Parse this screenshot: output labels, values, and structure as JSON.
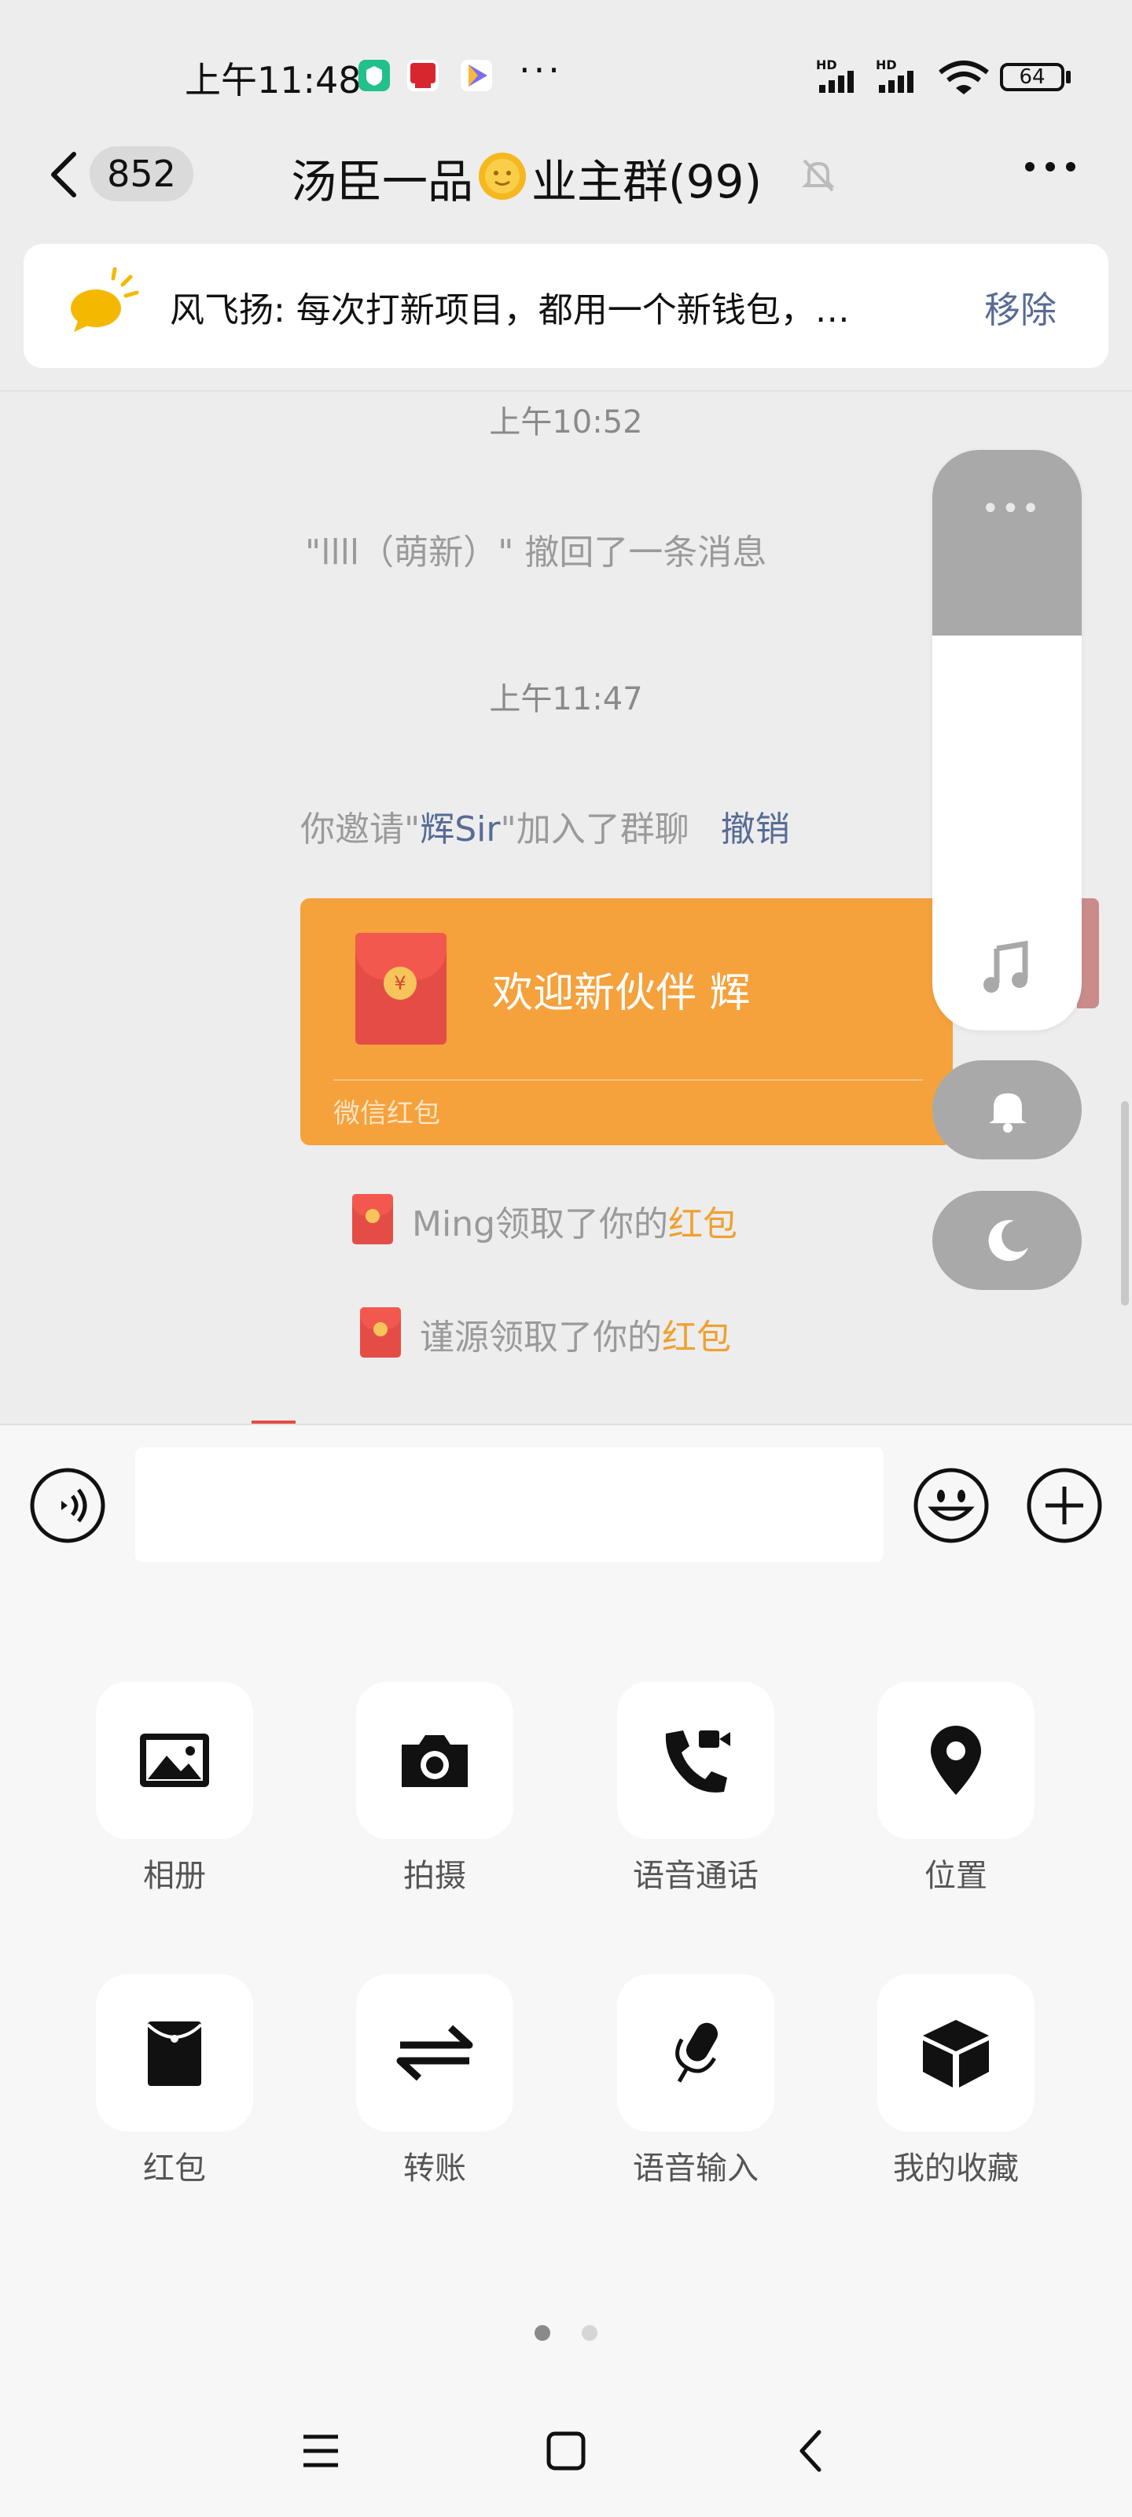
{
  "status_bar": {
    "time": "上午11:48",
    "more": "···",
    "network_1": "HD",
    "network_2": "HD",
    "battery": "64"
  },
  "header": {
    "unread_count": "852",
    "title_part1": "汤臣一品",
    "title_part2": "业主群(99)"
  },
  "pinned": {
    "text": "风飞扬: 每次打新项目，都用一个新钱包，…",
    "remove_label": "移除"
  },
  "chat": {
    "time_1": "上午10:52",
    "recall_msg": "\"llll（萌新）\" 撤回了一条消息",
    "time_2": "上午11:47",
    "invite_prefix": "你邀请\"",
    "invite_name": "辉Sir",
    "invite_suffix": "\"加入了群聊",
    "invite_undo": "撤销",
    "red_packet": {
      "title": "欢迎新伙伴  辉",
      "coin": "¥",
      "label": "微信红包"
    },
    "claim_1_text": "Ming领取了你的",
    "claim_1_link": "红包",
    "claim_2_text": "谨源领取了你的",
    "claim_2_link": "红包"
  },
  "floating_panel": {
    "dots": "•••",
    "level_percent": 32
  },
  "tools": [
    {
      "label": "相册",
      "icon": "photo-album-icon"
    },
    {
      "label": "拍摄",
      "icon": "camera-icon"
    },
    {
      "label": "语音通话",
      "icon": "voice-call-icon"
    },
    {
      "label": "位置",
      "icon": "location-pin-icon"
    },
    {
      "label": "红包",
      "icon": "red-packet-icon"
    },
    {
      "label": "转账",
      "icon": "transfer-icon"
    },
    {
      "label": "语音输入",
      "icon": "microphone-icon"
    },
    {
      "label": "我的收藏",
      "icon": "favorites-box-icon"
    }
  ],
  "pager": {
    "pages": 2,
    "current": 1
  },
  "colors": {
    "accent_blue": "#576b95",
    "red_packet_orange": "#f5a13c",
    "link_orange": "#f0a030"
  }
}
